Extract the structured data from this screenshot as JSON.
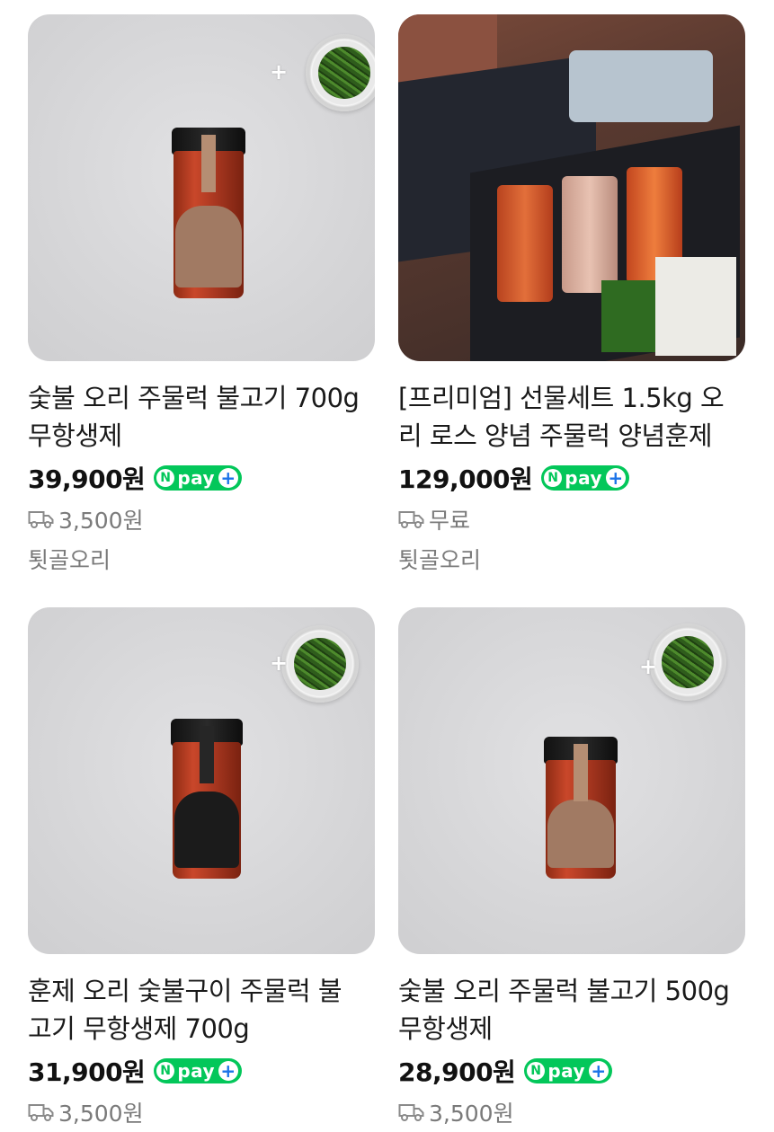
{
  "products": [
    {
      "title_line1": "숯불 오리 주물럭 불고기 700g",
      "title_line2": "무항생제",
      "price": "39,900원",
      "npay_label": "pay",
      "shipping": "3,500원",
      "seller": "툇골오리"
    },
    {
      "title_line1": "[프리미엄] 선물세트 1.5kg 오",
      "title_line2": "리 로스 양념 주물럭 양념훈제",
      "price": "129,000원",
      "npay_label": "pay",
      "shipping": "무료",
      "seller": "툇골오리"
    },
    {
      "title_line1": "훈제 오리 숯불구이 주물럭 불",
      "title_line2": "고기 무항생제 700g",
      "price": "31,900원",
      "npay_label": "pay",
      "shipping": "3,500원",
      "seller": ""
    },
    {
      "title_line1": "숯불 오리 주물럭 불고기 500g",
      "title_line2": "무항생제",
      "price": "28,900원",
      "npay_label": "pay",
      "shipping": "3,500원",
      "seller": ""
    }
  ],
  "icons": {
    "shipping": "truck-icon",
    "npay": "naver-pay-badge",
    "add": "plus-icon"
  },
  "colors": {
    "npay_green": "#03c75a",
    "muted_text": "#7a7a7a"
  }
}
